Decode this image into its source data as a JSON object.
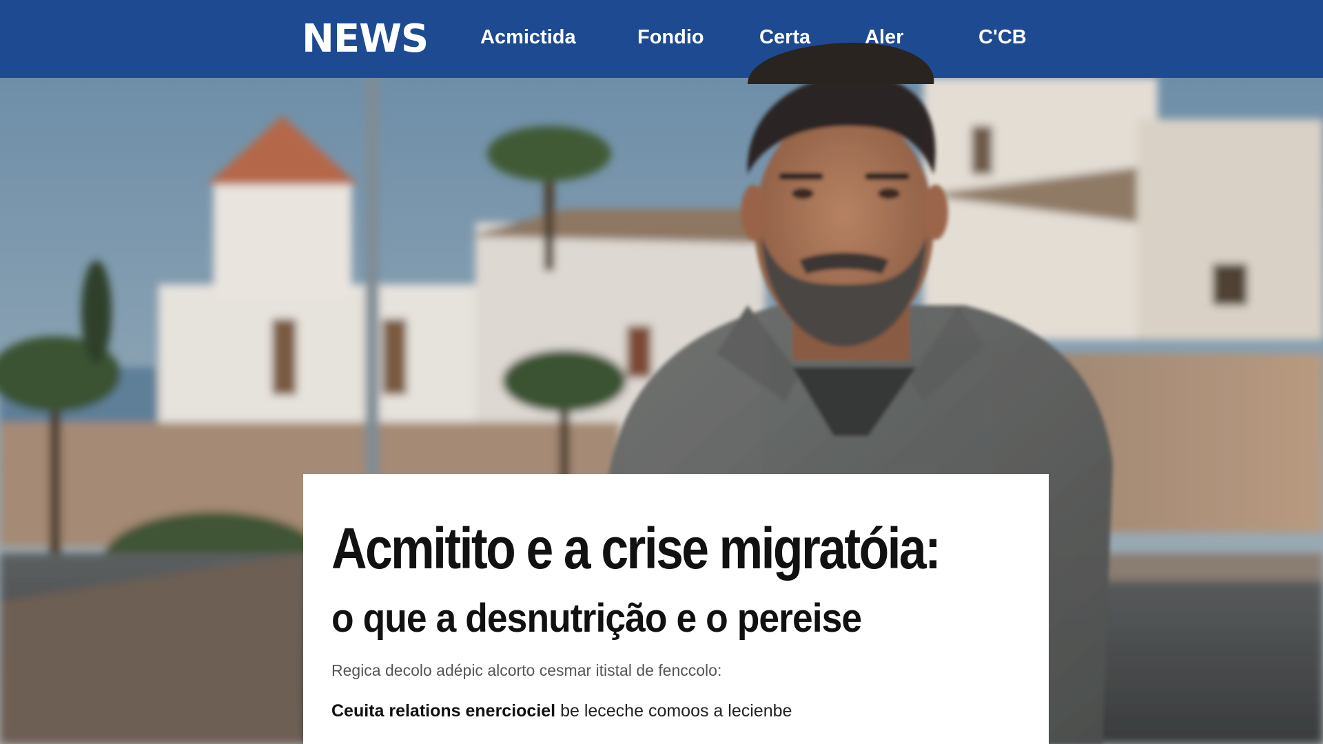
{
  "header": {
    "logo": "NEWS",
    "nav": [
      {
        "label": "Acmictida"
      },
      {
        "label": "Fondio"
      },
      {
        "label": "Certa"
      },
      {
        "label": "Aler"
      },
      {
        "label": "C'CB"
      }
    ]
  },
  "colors": {
    "nav_background": "#1d4a91",
    "card_background": "#ffffff"
  },
  "article": {
    "headline": "Acmitito e a crise migratóia:",
    "subheadline": "o que a desnutrição e o pereise",
    "dek": "Regica decolo adépic alcorto cesmar itistal de fenccolo:",
    "related_bold": "Ceuita relations enerciociel",
    "related_rest": " be leceche comoos a lecienbe"
  }
}
